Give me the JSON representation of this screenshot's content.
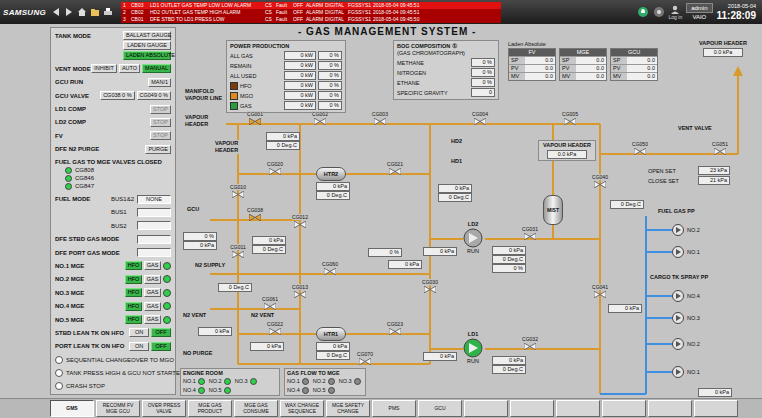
{
  "topbar": {
    "logo": "SAMSUNG"
  },
  "alarms": [
    {
      "no": "1",
      "tag": "CB03",
      "text": "LD1 OUTLET GAS TEMP LOW LOW ALARM",
      "area": "CS",
      "value": "Fault",
      "status": "OFF",
      "type": "ALARM",
      "signal": "DIGITAL",
      "group": "FGSSYS1",
      "time": "2018-05-04 09:45:51"
    },
    {
      "no": "2",
      "tag": "CB02",
      "text": "HD2 OUTLET GAS TEMP HIGH ALARM",
      "area": "CS",
      "value": "Fault",
      "status": "OFF",
      "type": "ALARM",
      "signal": "DIGITAL",
      "group": "FGSSYS1",
      "time": "2018-05-04 09:45:51"
    },
    {
      "no": "3",
      "tag": "CB01",
      "text": "DFE STBD TO LD1 PRESS LOW",
      "area": "CS",
      "value": "Fault",
      "status": "OFF",
      "type": "ALARM",
      "signal": "DIGITAL",
      "group": "FGSSYS1",
      "time": "2018-05-04 09:45:50"
    }
  ],
  "session": {
    "user": "admin",
    "login": "Log in",
    "host": "VAIO",
    "date": "2018-05-04",
    "time": "11:28:09"
  },
  "title": "- GAS MANAGEMENT SYSTEM -",
  "controls": [
    {
      "kind": "stack",
      "label": "TANK MODE",
      "buttons": [
        {
          "label": "BALLAST GAUGE",
          "selected": false,
          "disabled": false
        },
        {
          "label": "LADEN GAUGE",
          "selected": false,
          "disabled": false
        },
        {
          "label": "LADEN ABSOLUTE",
          "selected": true,
          "disabled": false
        }
      ]
    },
    {
      "kind": "buttons",
      "label": "VENT MODE",
      "buttons": [
        {
          "label": "INHIBIT",
          "selected": false,
          "disabled": false
        },
        {
          "label": "AUTO",
          "selected": false,
          "disabled": false
        },
        {
          "label": "MANUAL",
          "selected": true,
          "disabled": false
        }
      ]
    },
    {
      "kind": "buttons",
      "label": "GCU RUN",
      "buttons": [
        {
          "label": "MAN/1",
          "selected": false,
          "disabled": false
        }
      ]
    },
    {
      "kind": "buttons",
      "label": "GCU VALVE",
      "buttons": [
        {
          "label": "CG038 0 %",
          "selected": false,
          "disabled": false
        },
        {
          "label": "CG049 0 %",
          "selected": false,
          "disabled": false
        }
      ]
    },
    {
      "kind": "buttons",
      "label": "LD1 COMP",
      "buttons": [
        {
          "label": "STOP",
          "selected": false,
          "disabled": true
        }
      ]
    },
    {
      "kind": "buttons",
      "label": "LD2 COMP",
      "buttons": [
        {
          "label": "STOP",
          "selected": false,
          "disabled": true
        }
      ]
    },
    {
      "kind": "buttons",
      "label": "FV",
      "buttons": [
        {
          "label": "STOP",
          "selected": false,
          "disabled": true
        }
      ]
    },
    {
      "kind": "buttons",
      "label": "DFE N2 PURGE",
      "buttons": [
        {
          "label": "PURGE",
          "selected": false,
          "disabled": false
        }
      ]
    },
    {
      "kind": "indicators",
      "label": "FUEL GAS TO MGE VALVES CLOSED",
      "items": [
        {
          "label": "CG808",
          "on": true
        },
        {
          "label": "CG846",
          "on": true
        },
        {
          "label": "CG847",
          "on": true
        }
      ]
    },
    {
      "kind": "field",
      "label": "FUEL MODE",
      "sub": "BUS1&2",
      "value": "NONE"
    },
    {
      "kind": "field",
      "label": "",
      "sub": "BUS1",
      "value": ""
    },
    {
      "kind": "field",
      "label": "",
      "sub": "BUS2",
      "value": ""
    },
    {
      "kind": "field",
      "label": "DFE STBD GAS MODE",
      "sub": "",
      "value": ""
    },
    {
      "kind": "field",
      "label": "DFE PORT GAS MODE",
      "sub": "",
      "value": ""
    },
    {
      "kind": "mge",
      "label": "NO.1 MGE",
      "modes": [
        {
          "label": "HFO",
          "on": true
        },
        {
          "label": "GAS",
          "on": false
        }
      ],
      "running": true
    },
    {
      "kind": "mge",
      "label": "NO.2 MGE",
      "modes": [
        {
          "label": "HFO",
          "on": true
        },
        {
          "label": "GAS",
          "on": false
        }
      ],
      "running": true
    },
    {
      "kind": "mge",
      "label": "NO.3 MGE",
      "modes": [
        {
          "label": "HFO",
          "on": true
        },
        {
          "label": "GAS",
          "on": false
        }
      ],
      "running": true
    },
    {
      "kind": "mge",
      "label": "NO.4 MGE",
      "modes": [
        {
          "label": "HFO",
          "on": true
        },
        {
          "label": "GAS",
          "on": false
        }
      ],
      "running": true
    },
    {
      "kind": "mge",
      "label": "NO.5 MGE",
      "modes": [
        {
          "label": "HFO",
          "on": true
        },
        {
          "label": "GAS",
          "on": false
        }
      ],
      "running": true
    },
    {
      "kind": "buttons",
      "label": "STBD LEAN TK ON HFO",
      "buttons": [
        {
          "label": "ON",
          "selected": false,
          "disabled": false
        },
        {
          "label": "OFF",
          "selected": true,
          "disabled": false
        }
      ]
    },
    {
      "kind": "buttons",
      "label": "PORT LEAN TK ON HFO",
      "buttons": [
        {
          "label": "ON",
          "selected": false,
          "disabled": false
        },
        {
          "label": "OFF",
          "selected": true,
          "disabled": false
        }
      ]
    },
    {
      "kind": "radio",
      "label": "SEQUENTIAL CHANGEOVER TO MGO",
      "selected": false
    },
    {
      "kind": "radio",
      "label": "TANK PRESS HIGH & GCU NOT STARTED",
      "selected": false
    },
    {
      "kind": "radio",
      "label": "CRASH STOP",
      "selected": false
    }
  ],
  "power_production": {
    "title": "POWER PRODUCTION",
    "rows": [
      {
        "label": "ALL GAS",
        "kw": "0 kW",
        "pct": "0 %"
      },
      {
        "label": "REMAIN",
        "kw": "0 kW",
        "pct": "0 %"
      },
      {
        "label": "ALL USED",
        "kw": "0 kW",
        "pct": "0 %"
      }
    ],
    "fuels": [
      {
        "label": "HFO",
        "kw": "0 kW",
        "pct": "0 %",
        "color": "#7a3b10"
      },
      {
        "label": "MGO",
        "kw": "0 kW",
        "pct": "0 %",
        "color": "#e08a1e"
      },
      {
        "label": "GAS",
        "kw": "0 kW",
        "pct": "0 %",
        "color": "#2a9d3a"
      }
    ]
  },
  "bog": {
    "title": "BOG COMPOSITION ①",
    "subtitle": "(GAS CHROMATOGRAPH)",
    "rows": [
      {
        "label": "METHANE",
        "value": "0 %"
      },
      {
        "label": "NITROGEN",
        "value": "0 %"
      },
      {
        "label": "ETHANE",
        "value": "0 %"
      },
      {
        "label": "SPECIFIC GRAVITY",
        "value": "0"
      }
    ]
  },
  "summary": {
    "title": "Laden Absolute",
    "units": [
      {
        "name": "FV",
        "rows": [
          {
            "label": "SP",
            "value": "0.0"
          },
          {
            "label": "PV",
            "value": "0.0"
          },
          {
            "label": "MV",
            "value": "0.0"
          }
        ]
      },
      {
        "name": "MGE",
        "rows": [
          {
            "label": "SP",
            "value": "0.0"
          },
          {
            "label": "PV",
            "value": "0.0"
          },
          {
            "label": "MV",
            "value": "0.0"
          }
        ]
      },
      {
        "name": "GCU",
        "rows": [
          {
            "label": "SP",
            "value": "0.0"
          },
          {
            "label": "PV",
            "value": "0.0"
          },
          {
            "label": "MV",
            "value": "0.0"
          }
        ]
      }
    ]
  },
  "vapour_header": {
    "title": "VAPOUR HEADER",
    "value": "0.0 kPa"
  },
  "diagram": {
    "labels": [
      "MANIFOLD VAPOUR LINE",
      "VAPOUR HEADER",
      "VAPOUR HEADER",
      "GCU",
      "N2 SUPPLY",
      "N2 VENT",
      "N2 VENT",
      "NO PURGE",
      "HD2",
      "HD1"
    ],
    "readouts": [
      "0 kPa",
      "0 Deg.C",
      "0 kPa",
      "0 Deg.C",
      "0 kPa",
      "0 Deg.C",
      "0 kPa",
      "0 kPa",
      "0 Deg.C",
      "0 %",
      "0 Deg.C",
      "0 %",
      "0 kPa",
      "0 Deg.C",
      "0 %",
      "0 kPa",
      "0 Deg.C",
      "0 kPa",
      "0 kPa",
      "0 kPa",
      "0 Deg.C",
      "0 kPa",
      "0 kPa",
      "0 Deg.C",
      "0 kPa",
      "0 kPa",
      "0 kPa"
    ],
    "valves": [
      {
        "tag": "CG001",
        "open": true
      },
      {
        "tag": "CG002",
        "open": false
      },
      {
        "tag": "CG003",
        "open": false
      },
      {
        "tag": "CG004",
        "open": false
      },
      {
        "tag": "CG005",
        "open": false
      },
      {
        "tag": "CG010",
        "open": false
      },
      {
        "tag": "CG011",
        "open": false
      },
      {
        "tag": "CG012",
        "open": false
      },
      {
        "tag": "CG013",
        "open": false
      },
      {
        "tag": "CG020",
        "open": false
      },
      {
        "tag": "CG021",
        "open": false
      },
      {
        "tag": "CG022",
        "open": false
      },
      {
        "tag": "CG023",
        "open": false
      },
      {
        "tag": "CG030",
        "open": false
      },
      {
        "tag": "CG031",
        "open": false
      },
      {
        "tag": "CG032",
        "open": false
      },
      {
        "tag": "CG040",
        "open": false
      },
      {
        "tag": "CG041",
        "open": false
      },
      {
        "tag": "CG050",
        "open": false
      },
      {
        "tag": "CG051",
        "open": false
      },
      {
        "tag": "CG038",
        "open": true
      },
      {
        "tag": "CG060",
        "open": false
      },
      {
        "tag": "CG061",
        "open": false
      },
      {
        "tag": "CG070",
        "open": false
      }
    ],
    "heaters": [
      {
        "name": "HTR2"
      },
      {
        "name": "HTR1"
      }
    ],
    "compressors": [
      {
        "name": "LD2",
        "status": "RUN",
        "running": false
      },
      {
        "name": "LD1",
        "status": "RUN",
        "running": true
      }
    ],
    "mist": {
      "name": "MIST"
    },
    "vent": {
      "label": "VENT VALVE",
      "header": "VAPOUR HEADER",
      "value": "0.0 kPa",
      "settings": [
        {
          "label": "OPEN SET",
          "value": "23 kPa"
        },
        {
          "label": "CLOSE SET",
          "value": "21 kPa"
        }
      ]
    },
    "pump_groups": [
      {
        "title": "FUEL GAS PP",
        "pumps": [
          {
            "name": "NO.2",
            "running": false
          },
          {
            "name": "NO.1",
            "running": false
          }
        ]
      },
      {
        "title": "CARGO TK SPRAY PP",
        "pumps": [
          {
            "name": "NO.4",
            "running": false
          },
          {
            "name": "NO.3",
            "running": false
          },
          {
            "name": "NO.2",
            "running": false
          },
          {
            "name": "NO.1",
            "running": false
          }
        ]
      }
    ]
  },
  "engine_room": {
    "title": "ENGINE ROOM",
    "items": [
      {
        "name": "NO.1",
        "on": true
      },
      {
        "name": "NO.2",
        "on": true
      },
      {
        "name": "NO.3",
        "on": true
      },
      {
        "name": "NO.4",
        "on": true
      },
      {
        "name": "NO.5",
        "on": true
      }
    ]
  },
  "gas_flow": {
    "title": "GAS FLOW TO MGE",
    "items": [
      {
        "name": "NO.1",
        "on": false
      },
      {
        "name": "NO.2",
        "on": false
      },
      {
        "name": "NO.3",
        "on": false
      },
      {
        "name": "NO.4",
        "on": false
      },
      {
        "name": "NO.5",
        "on": false
      }
    ]
  },
  "tabs": [
    {
      "label": "GMS",
      "selected": true
    },
    {
      "label": "RECOMM FV MGE GCU",
      "selected": false
    },
    {
      "label": "OVER PRESS VALVE",
      "selected": false
    },
    {
      "label": "MGE GAS PRODUCT",
      "selected": false
    },
    {
      "label": "MGE GAS CONSUME",
      "selected": false
    },
    {
      "label": "WAX CHANGE SEQUENCE",
      "selected": false
    },
    {
      "label": "MGE SAFETY CHANGE",
      "selected": false
    },
    {
      "label": "PMS",
      "selected": false
    },
    {
      "label": "GCU",
      "selected": false
    },
    {
      "label": "",
      "selected": false
    },
    {
      "label": "",
      "selected": false
    },
    {
      "label": "",
      "selected": false
    },
    {
      "label": "",
      "selected": false
    },
    {
      "label": "",
      "selected": false
    },
    {
      "label": "",
      "selected": false
    }
  ]
}
